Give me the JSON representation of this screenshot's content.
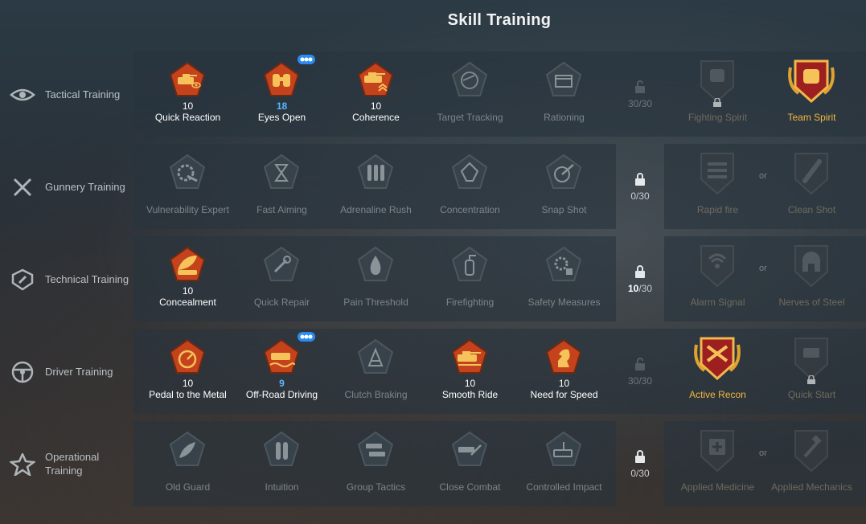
{
  "page": {
    "title": "Skill Training"
  },
  "colors": {
    "gold": "#f3b640",
    "orange_skill": "#e0642a",
    "level_blue": "#5ab6ff",
    "locked_gray": "#7d858a"
  },
  "rows": [
    {
      "category": "Tactical Training",
      "category_icon": "eye-icon",
      "skills": [
        {
          "name": "Quick Reaction",
          "level": "10",
          "active": true,
          "icon": "tank-eye-icon"
        },
        {
          "name": "Eyes Open",
          "level": "18",
          "active": true,
          "icon": "binoculars-icon",
          "level_blue": true,
          "badge": "crew-badge-icon"
        },
        {
          "name": "Coherence",
          "level": "10",
          "active": true,
          "icon": "tank-chevrons-icon"
        },
        {
          "name": "Target Tracking",
          "level": "",
          "active": false,
          "icon": "target-tracking-icon"
        },
        {
          "name": "Rationing",
          "level": "",
          "active": false,
          "icon": "crate-icon"
        }
      ],
      "lock": {
        "text": "30/30",
        "faded": true
      },
      "talents": [
        {
          "name": "Fighting Spirit",
          "active": false,
          "icon": "fist-icon"
        },
        {
          "name": "Team Spirit",
          "active": true,
          "icon": "team-spirit-icon"
        }
      ]
    },
    {
      "category": "Gunnery Training",
      "category_icon": "crossed-swords-icon",
      "skills": [
        {
          "name": "Vulnerability Expert",
          "level": "",
          "active": false,
          "icon": "gear-shell-icon"
        },
        {
          "name": "Fast Aiming",
          "level": "",
          "active": false,
          "icon": "hourglass-icon"
        },
        {
          "name": "Adrenaline Rush",
          "level": "",
          "active": false,
          "icon": "shells-icon"
        },
        {
          "name": "Concentration",
          "level": "",
          "active": false,
          "icon": "diamond-icon"
        },
        {
          "name": "Snap Shot",
          "level": "",
          "active": false,
          "icon": "snap-shot-icon"
        }
      ],
      "lock": {
        "text": "0/30",
        "faded": false
      },
      "or_label": "or",
      "talents": [
        {
          "name": "Rapid fire",
          "active": false,
          "icon": "rapid-fire-icon"
        },
        {
          "name": "Clean Shot",
          "active": false,
          "icon": "clean-shot-icon"
        }
      ]
    },
    {
      "category": "Technical Training",
      "category_icon": "wrench-shield-icon",
      "skills": [
        {
          "name": "Concealment",
          "level": "10",
          "active": true,
          "icon": "leaf-tank-icon"
        },
        {
          "name": "Quick Repair",
          "level": "",
          "active": false,
          "icon": "wrench-icon"
        },
        {
          "name": "Pain Threshold",
          "level": "",
          "active": false,
          "icon": "drop-icon"
        },
        {
          "name": "Firefighting",
          "level": "",
          "active": false,
          "icon": "extinguisher-icon"
        },
        {
          "name": "Safety Measures",
          "level": "",
          "active": false,
          "icon": "gear-box-icon"
        }
      ],
      "lock": {
        "text_bold": "10",
        "text": "/30",
        "faded": false
      },
      "or_label": "or",
      "talents": [
        {
          "name": "Alarm Signal",
          "active": false,
          "icon": "signal-icon"
        },
        {
          "name": "Nerves of Steel",
          "active": false,
          "icon": "helmet-icon"
        }
      ]
    },
    {
      "category": "Driver Training",
      "category_icon": "steering-wheel-icon",
      "skills": [
        {
          "name": "Pedal to the Metal",
          "level": "10",
          "active": true,
          "icon": "pedal-icon"
        },
        {
          "name": "Off-Road Driving",
          "level": "9",
          "active": true,
          "icon": "offroad-icon",
          "level_blue": true,
          "badge": "crew-badge-icon"
        },
        {
          "name": "Clutch Braking",
          "level": "",
          "active": false,
          "icon": "brake-icon"
        },
        {
          "name": "Smooth Ride",
          "level": "10",
          "active": true,
          "icon": "smooth-ride-icon"
        },
        {
          "name": "Need for Speed",
          "level": "10",
          "active": true,
          "icon": "knight-icon"
        }
      ],
      "lock": {
        "text": "30/30",
        "faded": true
      },
      "talents": [
        {
          "name": "Active Recon",
          "active": true,
          "icon": "active-recon-icon"
        },
        {
          "name": "Quick Start",
          "active": false,
          "icon": "quick-start-icon"
        }
      ]
    },
    {
      "category": "Operational Training",
      "category_icon": "star-icon",
      "skills": [
        {
          "name": "Old Guard",
          "level": "",
          "active": false,
          "icon": "laurel-icon"
        },
        {
          "name": "Intuition",
          "level": "",
          "active": false,
          "icon": "shells-pair-icon"
        },
        {
          "name": "Group Tactics",
          "level": "",
          "active": false,
          "icon": "group-tanks-icon"
        },
        {
          "name": "Close Combat",
          "level": "",
          "active": false,
          "icon": "close-combat-icon"
        },
        {
          "name": "Controlled Impact",
          "level": "",
          "active": false,
          "icon": "impact-icon"
        }
      ],
      "lock": {
        "text": "0/30",
        "faded": false
      },
      "or_label": "or",
      "talents": [
        {
          "name": "Applied Medicine",
          "active": false,
          "icon": "medkit-icon"
        },
        {
          "name": "Applied Mechanics",
          "active": false,
          "icon": "hammer-icon"
        }
      ]
    }
  ]
}
